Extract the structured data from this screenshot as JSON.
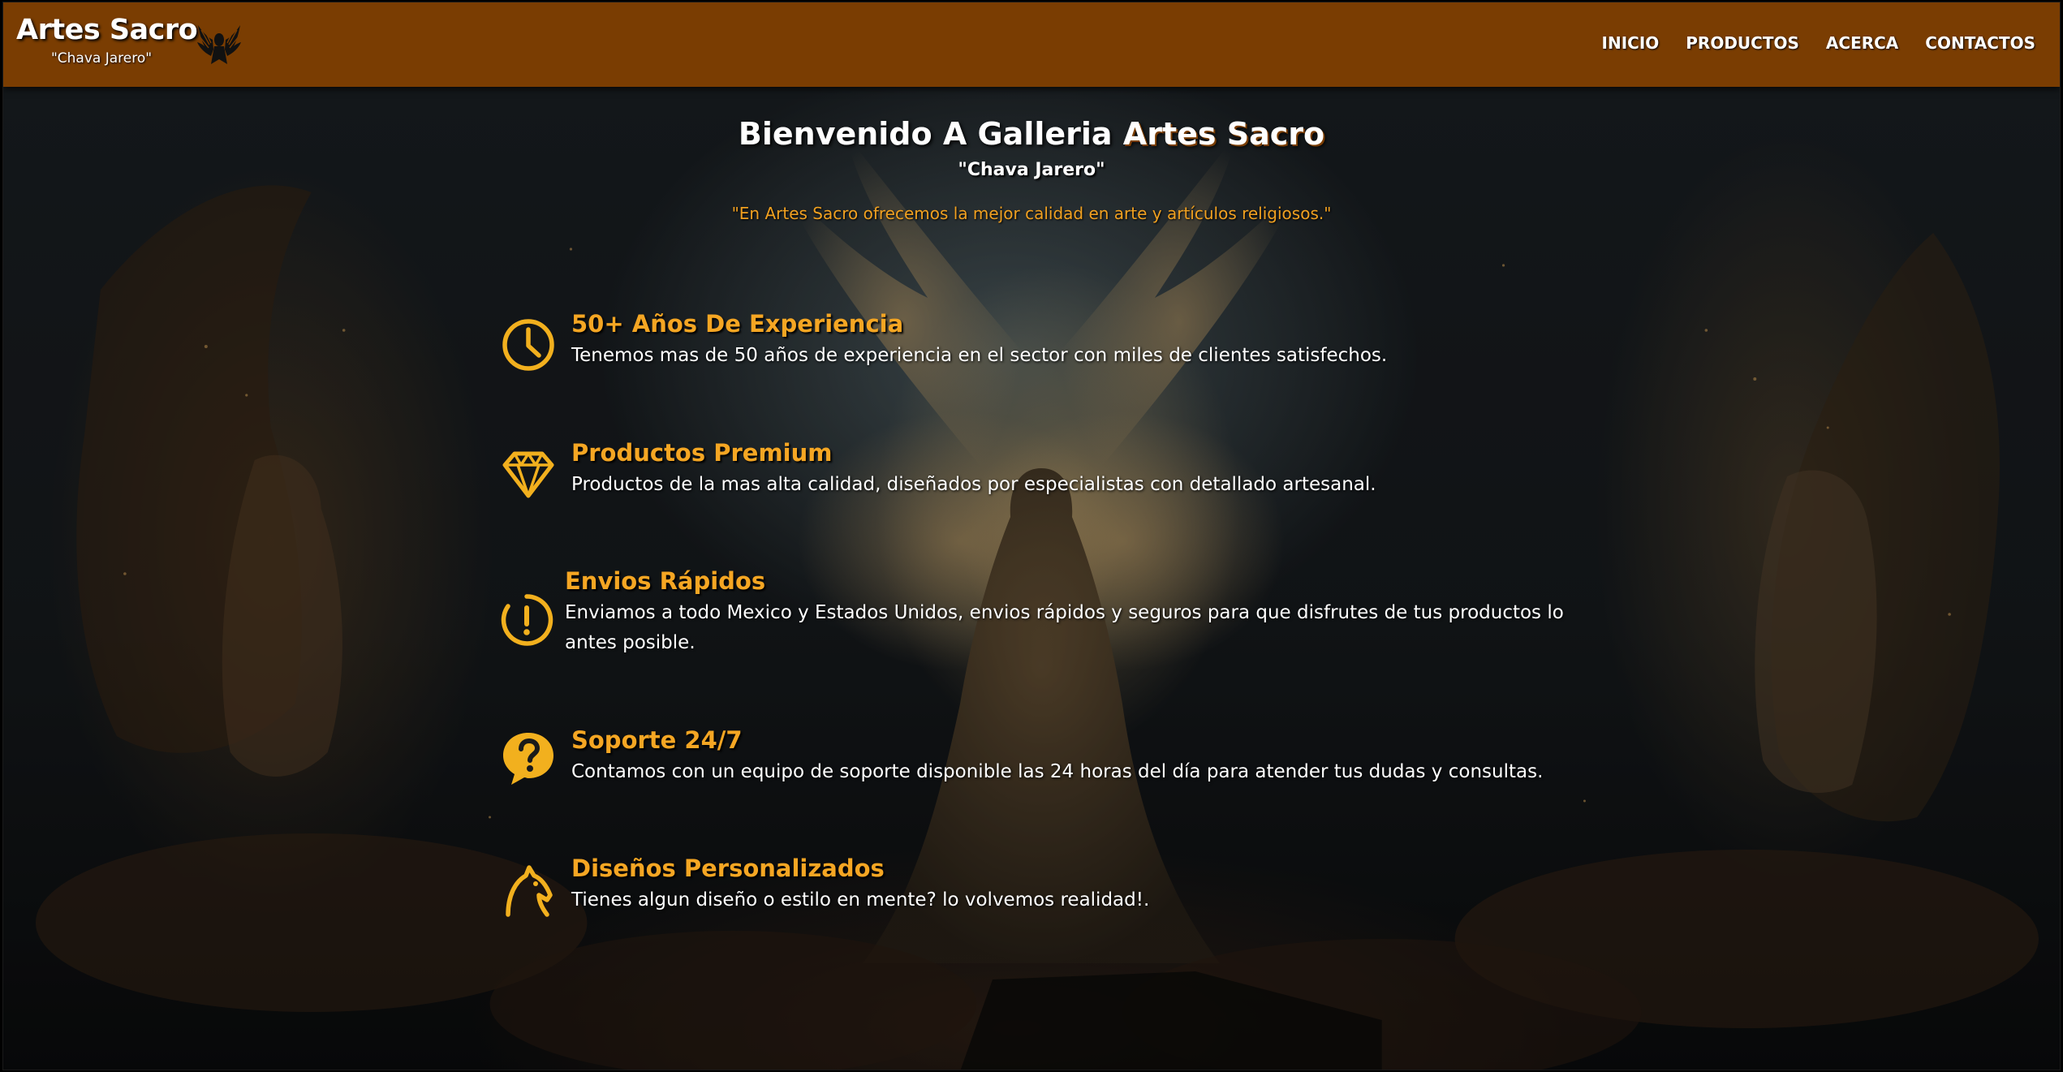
{
  "navbar": {
    "brand_title": "Artes Sacro",
    "brand_subtitle": "\"Chava Jarero\"",
    "logo_icon": "winged-emblem-icon",
    "links": [
      {
        "label": "INICIO"
      },
      {
        "label": "PRODUCTOS"
      },
      {
        "label": "ACERCA"
      },
      {
        "label": "CONTACTOS"
      }
    ]
  },
  "hero": {
    "welcome_prefix": "Bienvenido A Galleria",
    "welcome_accent": "Artes Sacro",
    "subtitle": "\"Chava Jarero\"",
    "tagline": "\"En Artes Sacro ofrecemos la mejor calidad en arte y artículos religiosos.\""
  },
  "features": [
    {
      "icon": "clock-icon",
      "title": "50+ Años De Experiencia",
      "description": "Tenemos mas de 50 años de experiencia en el sector con miles de clientes satisfechos."
    },
    {
      "icon": "diamond-icon",
      "title": "Productos Premium",
      "description": "Productos de la mas alta calidad, diseñados por especialistas con detallado artesanal."
    },
    {
      "icon": "alert-circle-icon",
      "title": "Envios Rápidos",
      "description": "Enviamos a todo Mexico y Estados Unidos, envios rápidos y seguros para que disfrutes de tus productos lo antes posible."
    },
    {
      "icon": "question-bubble-icon",
      "title": "Soporte 24/7",
      "description": "Contamos con un equipo de soporte disponible las 24 horas del día para atender tus dudas y consultas."
    },
    {
      "icon": "horse-head-icon",
      "title": "Diseños Personalizados",
      "description": "Tienes algun diseño o estilo en mente? lo volvemos realidad!."
    }
  ],
  "colors": {
    "navbar": "#7a3d02",
    "accent": "#f5a623",
    "text": "#ffffff"
  }
}
